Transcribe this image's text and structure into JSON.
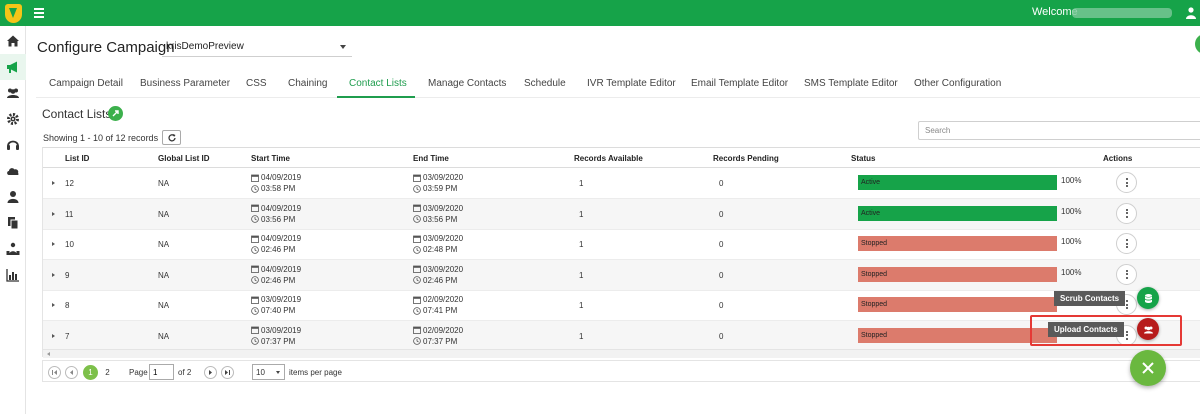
{
  "topbar": {
    "welcome": "Welcome"
  },
  "campaign": {
    "title": "Configure Campaign",
    "selected": "krisDemoPreview"
  },
  "tabs": [
    {
      "label": "Campaign Detail"
    },
    {
      "label": "Business Parameter"
    },
    {
      "label": "CSS"
    },
    {
      "label": "Chaining"
    },
    {
      "label": "Contact Lists"
    },
    {
      "label": "Manage Contacts"
    },
    {
      "label": "Schedule"
    },
    {
      "label": "IVR Template Editor"
    },
    {
      "label": "Email Template Editor"
    },
    {
      "label": "SMS Template Editor"
    },
    {
      "label": "Other Configuration"
    }
  ],
  "section": {
    "title": "Contact Lists",
    "showing": "Showing 1 - 10 of 12 records"
  },
  "search": {
    "placeholder": "Search"
  },
  "table": {
    "headers": [
      "List ID",
      "Global List ID",
      "Start Time",
      "End Time",
      "Records Available",
      "Records Pending",
      "Status",
      "Actions"
    ],
    "rows": [
      {
        "id": "12",
        "global": "NA",
        "start_date": "04/09/2019",
        "start_time": "03:58 PM",
        "end_date": "03/09/2020",
        "end_time": "03:59 PM",
        "available": "1",
        "pending": "0",
        "status": "Active",
        "percent": "100%"
      },
      {
        "id": "11",
        "global": "NA",
        "start_date": "04/09/2019",
        "start_time": "03:56 PM",
        "end_date": "03/09/2020",
        "end_time": "03:56 PM",
        "available": "1",
        "pending": "0",
        "status": "Active",
        "percent": "100%"
      },
      {
        "id": "10",
        "global": "NA",
        "start_date": "04/09/2019",
        "start_time": "02:46 PM",
        "end_date": "03/09/2020",
        "end_time": "02:48 PM",
        "available": "1",
        "pending": "0",
        "status": "Stopped",
        "percent": "100%"
      },
      {
        "id": "9",
        "global": "NA",
        "start_date": "04/09/2019",
        "start_time": "02:46 PM",
        "end_date": "03/09/2020",
        "end_time": "02:46 PM",
        "available": "1",
        "pending": "0",
        "status": "Stopped",
        "percent": "100%"
      },
      {
        "id": "8",
        "global": "NA",
        "start_date": "03/09/2019",
        "start_time": "07:40 PM",
        "end_date": "02/09/2020",
        "end_time": "07:41 PM",
        "available": "1",
        "pending": "0",
        "status": "Stopped",
        "percent": "100%"
      },
      {
        "id": "7",
        "global": "NA",
        "start_date": "03/09/2019",
        "start_time": "07:37 PM",
        "end_date": "02/09/2020",
        "end_time": "07:37 PM",
        "available": "1",
        "pending": "0",
        "status": "Stopped",
        "percent": ""
      }
    ]
  },
  "pager": {
    "page1": "1",
    "page2": "2",
    "page_label": "Page",
    "page_value": "1",
    "of_label": "of 2",
    "per_page": "10",
    "per_page_label": "items per page"
  },
  "fab": {
    "scrub": "Scrub Contacts",
    "upload": "Upload Contacts"
  },
  "colors": {
    "brand": "#16a349",
    "active": "#16a349",
    "stopped": "#dc7b6c",
    "upload_fab": "#b71c1c",
    "main_fab": "#6ab83f"
  }
}
